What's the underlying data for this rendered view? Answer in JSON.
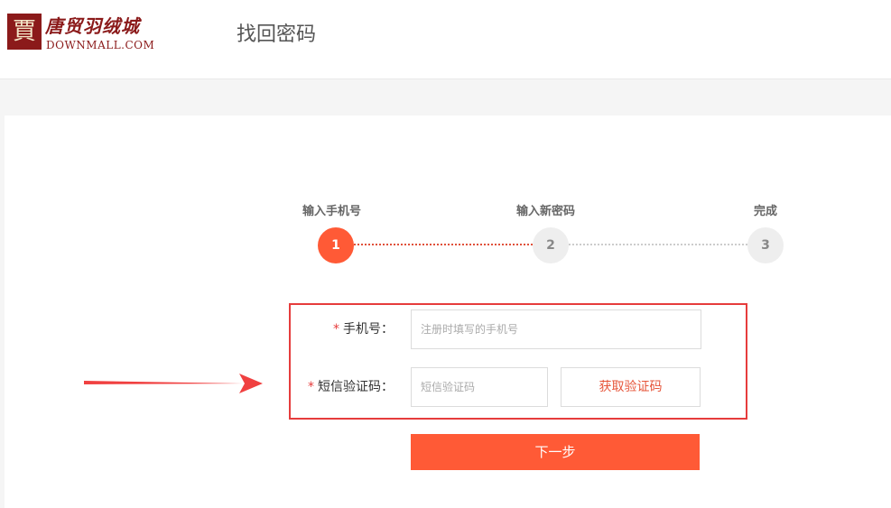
{
  "header": {
    "logo_glyph": "賈",
    "logo_cn": "唐贸羽绒城",
    "logo_en": "DOWNMALL.COM",
    "page_title": "找回密码"
  },
  "steps": [
    {
      "label": "输入手机号",
      "number": "1",
      "active": true
    },
    {
      "label": "输入新密码",
      "number": "2",
      "active": false
    },
    {
      "label": "完成",
      "number": "3",
      "active": false
    }
  ],
  "form": {
    "phone": {
      "required_mark": "*",
      "label": "手机号：",
      "placeholder": "注册时填写的手机号"
    },
    "sms": {
      "required_mark": "*",
      "label": "短信验证码：",
      "placeholder": "短信验证码",
      "button_label": "获取验证码"
    },
    "next_button_label": "下一步"
  },
  "colors": {
    "accent": "#ff5a36",
    "highlight_border": "#e63c3c",
    "brand": "#8b1a1a"
  }
}
